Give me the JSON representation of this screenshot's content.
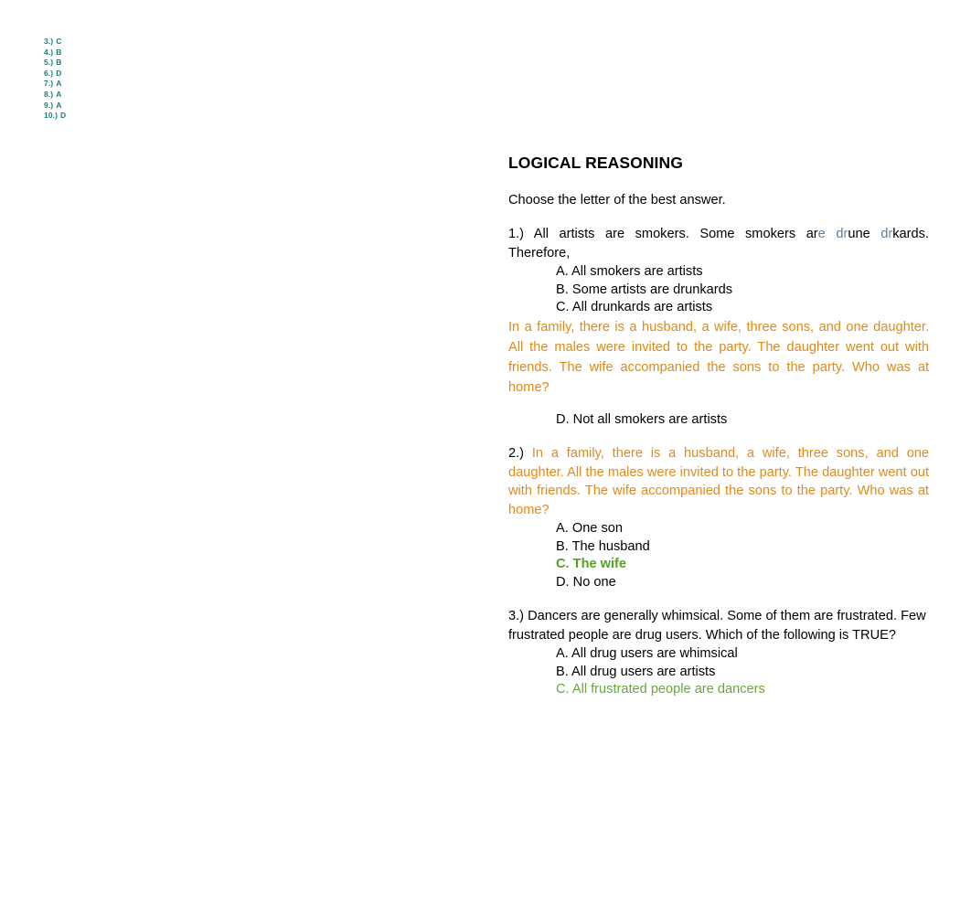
{
  "answer_key": {
    "items": [
      {
        "num": "3.)",
        "answer": "C"
      },
      {
        "num": "4.)",
        "answer": "B"
      },
      {
        "num": "5.)",
        "answer": "B"
      },
      {
        "num": "6.)",
        "answer": "D"
      },
      {
        "num": "7.)",
        "answer": "A"
      },
      {
        "num": "8.)",
        "answer": "A"
      },
      {
        "num": "9.)",
        "answer": "A"
      },
      {
        "num": "10.)",
        "answer": "D"
      }
    ]
  },
  "document": {
    "heading": "LOGICAL REASONING",
    "instruction": "Choose the letter of the best answer.",
    "q1": {
      "prefix": "1.) All artists are smokers. Some smokers ar",
      "run_e": "e",
      "run_space1": " ",
      "run_d1": "d",
      "run_r1": "r",
      "run_une": "une",
      "run_space2": " ",
      "run_d2": "d",
      "run_r2": "r",
      "run_kards": "kards.",
      "suffix": " Therefore,",
      "options": [
        "A. All smokers are artists",
        "B. Some artists are drunkards",
        "C. All drunkards are artists"
      ],
      "inserted_paragraph": "In a family, there is a husband, a wife, three sons, and one daughter. All the males were invited to the party. The daughter went out with friends. The wife accompanied the sons to the party. Who was at home?",
      "option_d": "D. Not all smokers are artists"
    },
    "q2": {
      "number": "2.)",
      "text": "In a family, there is a husband, a wife, three sons, and one daughter. All the males were invited to the party. The daughter went out with friends. The wife accompanied the sons to the party. Who was at home?",
      "options": [
        {
          "label": "A. One son",
          "style": "normal"
        },
        {
          "label": "B. The husband",
          "style": "normal"
        },
        {
          "label": "C. The wife",
          "style": "green-bold"
        },
        {
          "label": "D. No one",
          "style": "normal"
        }
      ]
    },
    "q3": {
      "text": "3.) Dancers are generally whimsical. Some of them are frustrated. Few frustrated people are drug users. Which of the following is TRUE?",
      "options": [
        {
          "label": "A. All drug users are whimsical",
          "style": "normal"
        },
        {
          "label": "B. All drug users are artists",
          "style": "normal"
        },
        {
          "label": "C. All frustrated people are dancers",
          "style": "green"
        }
      ]
    }
  },
  "colors": {
    "answer_key_teal": "#1F7A7A",
    "orange": "#DD8A17",
    "slate_blue": "#5A7E9E",
    "green_bold": "#54A124",
    "green": "#66A93B",
    "black": "#000000",
    "background": "#FFFFFF"
  }
}
